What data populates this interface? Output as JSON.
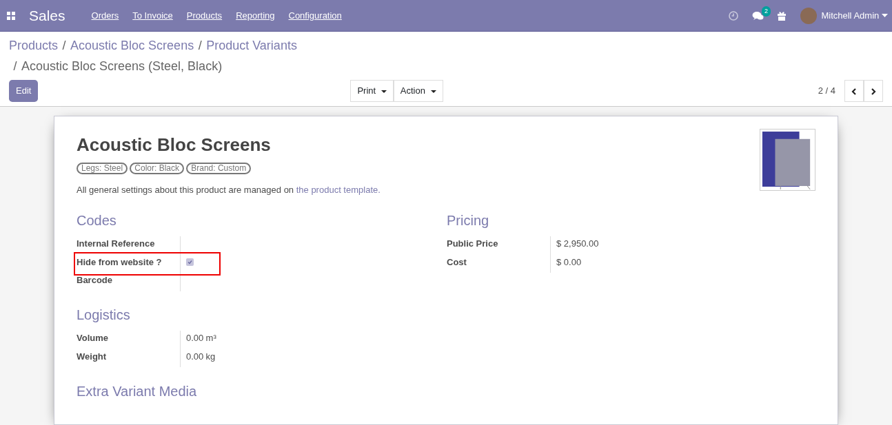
{
  "app": {
    "name": "Sales",
    "menu": [
      "Orders",
      "To Invoice",
      "Products",
      "Reporting",
      "Configuration"
    ],
    "messages_badge": "2",
    "user": "Mitchell Admin"
  },
  "breadcrumb": [
    "Products",
    "Acoustic Bloc Screens",
    "Product Variants"
  ],
  "breadcrumb_separator": "/",
  "current_page": "Acoustic Bloc Screens (Steel, Black)",
  "edit_button": "Edit",
  "toolbar": [
    "Print",
    "Action"
  ],
  "pager": "2 / 4",
  "product": {
    "name": "Acoustic Bloc Screens",
    "tags": [
      "Legs: Steel",
      "Color: Black",
      "Brand: Custom"
    ],
    "note": "All general settings about this product are managed on ",
    "note_link": "the product template."
  },
  "groups": [
    {
      "title": "Codes",
      "fields": [
        {
          "label": "Internal Reference",
          "kind": "text",
          "highlighted": false
        },
        {
          "label": "Hide from website ?",
          "kind": "checkbox",
          "checked": true,
          "highlighted": true
        },
        {
          "label": "Barcode",
          "kind": "text",
          "highlighted": false
        }
      ]
    },
    {
      "title": "Pricing",
      "fields": [
        {
          "label": "Public Price",
          "kind": "text",
          "value": "$ 2,950.00",
          "highlighted": false
        },
        {
          "label": "Cost",
          "kind": "text",
          "value": "$ 0.00",
          "highlighted": false
        }
      ]
    },
    {
      "title": "Logistics",
      "fields": [
        {
          "label": "Volume",
          "kind": "unit",
          "value": "0.00",
          "unit": "m³",
          "highlighted": false
        },
        {
          "label": "Weight",
          "kind": "unit",
          "value": "0.00",
          "unit": "kg",
          "highlighted": false
        }
      ]
    }
  ],
  "next_section": "Extra Variant Media"
}
